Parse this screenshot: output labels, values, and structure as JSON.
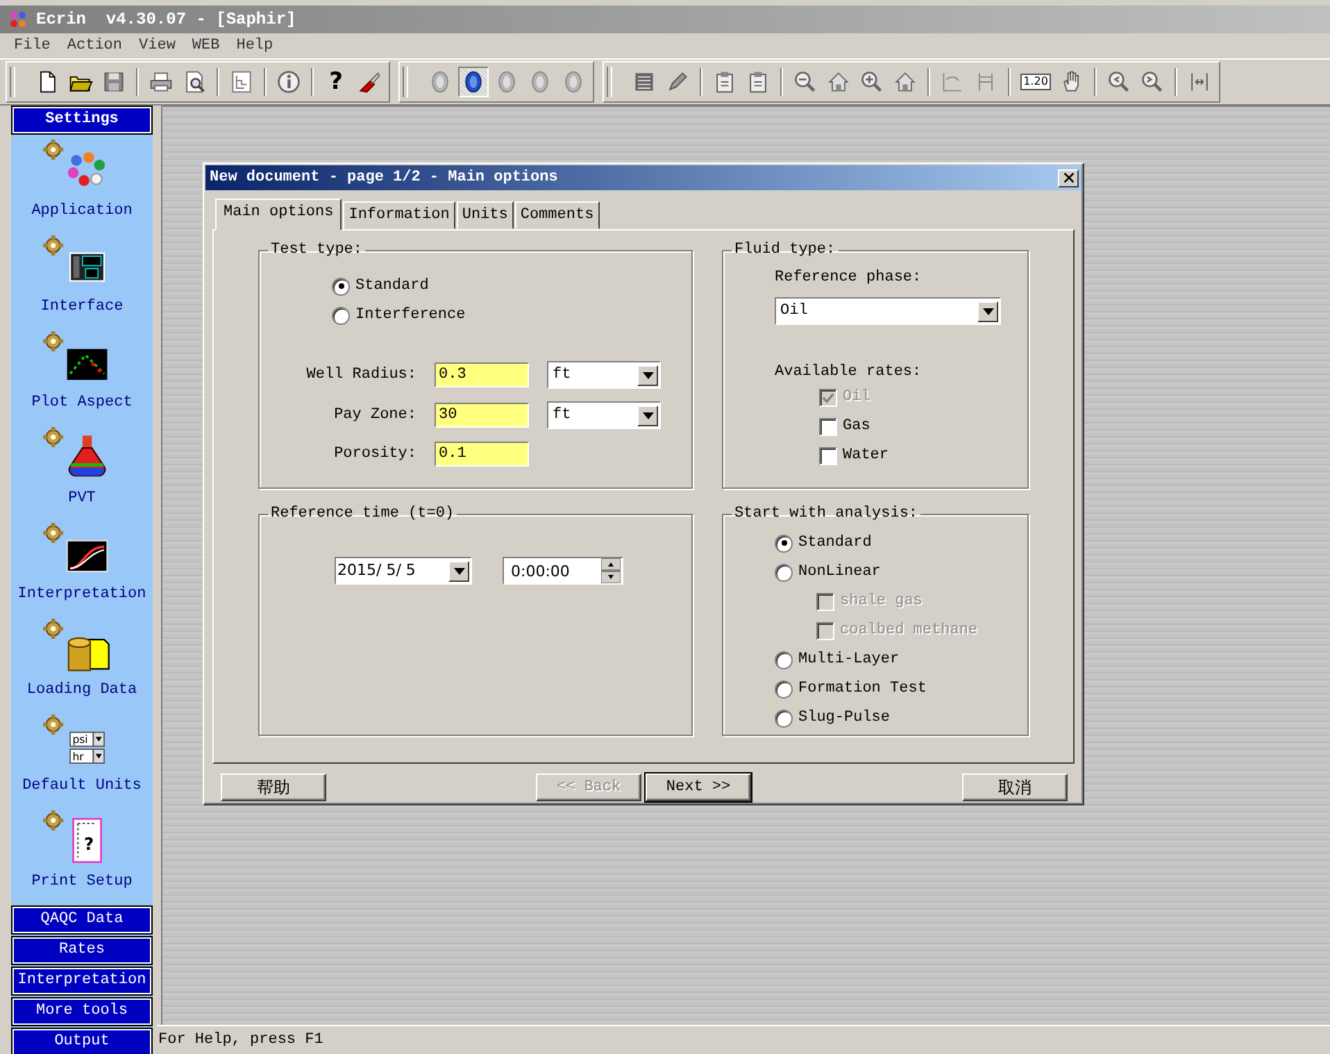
{
  "window": {
    "title": "Ecrin  v4.30.07 - [Saphir]"
  },
  "menu": [
    "File",
    "Action",
    "View",
    "WEB",
    "Help"
  ],
  "toolbar": {
    "groups": [
      {
        "items": [
          {
            "kind": "new"
          },
          {
            "kind": "open"
          },
          {
            "kind": "save"
          },
          {
            "kind": "sep"
          },
          {
            "kind": "print"
          },
          {
            "kind": "preview"
          },
          {
            "kind": "sep"
          },
          {
            "kind": "tree"
          },
          {
            "kind": "sep"
          },
          {
            "kind": "info"
          },
          {
            "kind": "sep"
          },
          {
            "kind": "help",
            "text": "?"
          },
          {
            "kind": "tool"
          }
        ]
      },
      {
        "items": [
          {
            "kind": "gem",
            "pressed": false
          },
          {
            "kind": "gem",
            "pressed": true
          },
          {
            "kind": "gem",
            "pressed": false
          },
          {
            "kind": "gem",
            "pressed": false
          },
          {
            "kind": "gem",
            "pressed": false
          }
        ]
      },
      {
        "items": [
          {
            "kind": "list"
          },
          {
            "kind": "pen"
          },
          {
            "kind": "sep"
          },
          {
            "kind": "clip"
          },
          {
            "kind": "clip"
          },
          {
            "kind": "sep"
          },
          {
            "kind": "zoomout"
          },
          {
            "kind": "home"
          },
          {
            "kind": "zoomin"
          },
          {
            "kind": "home"
          },
          {
            "kind": "sep"
          },
          {
            "kind": "curve"
          },
          {
            "kind": "frame"
          },
          {
            "kind": "sep"
          },
          {
            "kind": "scale",
            "text": "1.20"
          },
          {
            "kind": "hand"
          },
          {
            "kind": "sep"
          },
          {
            "kind": "zoomprev"
          },
          {
            "kind": "zoomnext"
          },
          {
            "kind": "sep"
          },
          {
            "kind": "arrows"
          }
        ]
      }
    ]
  },
  "sidebar": {
    "header": "Settings",
    "items": [
      {
        "label": "Application",
        "kind": "application"
      },
      {
        "label": "Interface",
        "kind": "interface"
      },
      {
        "label": "Plot Aspect",
        "kind": "plot"
      },
      {
        "label": "PVT",
        "kind": "pvt"
      },
      {
        "label": "Interpretation",
        "kind": "interpretation"
      },
      {
        "label": "Loading Data",
        "kind": "loading"
      },
      {
        "label": "Default Units",
        "kind": "units",
        "icon_labels": [
          "psi",
          "hr"
        ]
      },
      {
        "label": "Print Setup",
        "kind": "print",
        "icon_labels": [
          "?"
        ]
      }
    ],
    "sections": [
      "QAQC Data",
      "Rates",
      "Interpretation",
      "More tools",
      "Output"
    ]
  },
  "dialog": {
    "title": "New document - page 1/2 - Main options",
    "tabs": [
      {
        "label": "Main options",
        "selected": true
      },
      {
        "label": "Information",
        "selected": false
      },
      {
        "label": "Units",
        "selected": false
      },
      {
        "label": "Comments",
        "selected": false
      }
    ],
    "test_type": {
      "title": "Test type:",
      "options": [
        {
          "label": "Standard",
          "selected": true
        },
        {
          "label": "Interference",
          "selected": false
        }
      ],
      "fields": [
        {
          "label": "Well Radius:",
          "value": "0.3",
          "unit": "ft"
        },
        {
          "label": "Pay Zone:",
          "value": "30",
          "unit": "ft"
        },
        {
          "label": "Porosity:",
          "value": "0.1"
        }
      ]
    },
    "reference_time": {
      "title": "Reference time (t=0)",
      "date": "2015/ 5/ 5",
      "time": "0:00:00"
    },
    "fluid_type": {
      "title": "Fluid type:",
      "reference_phase_label": "Reference phase:",
      "reference_phase": "Oil",
      "rates_label": "Available rates:",
      "rates": [
        {
          "label": "Oil",
          "checked": true,
          "disabled": true
        },
        {
          "label": "Gas",
          "checked": false,
          "disabled": false
        },
        {
          "label": "Water",
          "checked": false,
          "disabled": false
        }
      ]
    },
    "analysis": {
      "title": "Start with analysis:",
      "options": [
        {
          "label": "Standard",
          "selected": true
        },
        {
          "label": "NonLinear",
          "selected": false,
          "children": [
            {
              "label": "shale gas",
              "checked": false,
              "disabled": true
            },
            {
              "label": "coalbed methane",
              "checked": false,
              "disabled": true
            }
          ]
        },
        {
          "label": "Multi-Layer",
          "selected": false
        },
        {
          "label": "Formation Test",
          "selected": false
        },
        {
          "label": "Slug-Pulse",
          "selected": false
        }
      ]
    },
    "buttons": [
      {
        "label": "帮助",
        "disabled": false,
        "default": false
      },
      {
        "label": "<< Back",
        "disabled": true,
        "default": false
      },
      {
        "label": "Next >>",
        "disabled": false,
        "default": true
      },
      {
        "label": "取消",
        "disabled": false,
        "default": false
      }
    ]
  },
  "status_bar": "For Help, press F1"
}
